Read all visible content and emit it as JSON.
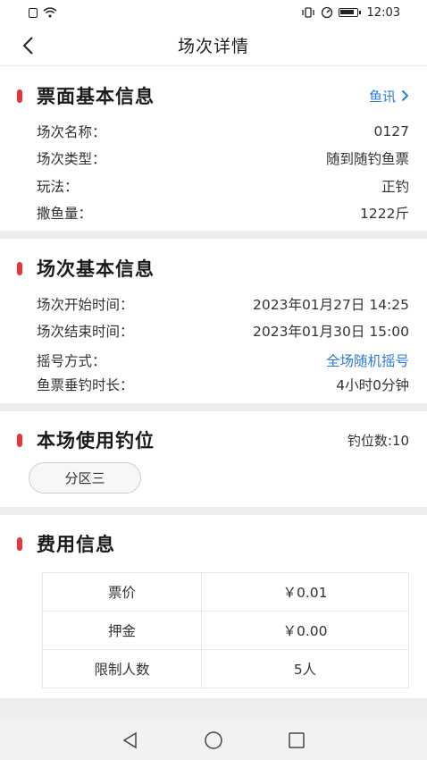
{
  "status_bar": {
    "time": "12:03"
  },
  "nav": {
    "title": "场次详情"
  },
  "ticket_info": {
    "title": "票面基本信息",
    "link": "鱼讯",
    "rows": [
      {
        "label": "场次名称：",
        "value": "0127"
      },
      {
        "label": "场次类型：",
        "value": "随到随钓鱼票"
      },
      {
        "label": "玩法：",
        "value": "正钓"
      },
      {
        "label": "撒鱼量：",
        "value": "1222斤"
      }
    ]
  },
  "session_info": {
    "title": "场次基本信息",
    "rows": [
      {
        "label": "场次开始时间：",
        "value": "2023年01月27日 14:25"
      },
      {
        "label": "场次结束时间：",
        "value": "2023年01月30日 15:00"
      },
      {
        "label": "摇号方式：",
        "value": "全场随机摇号"
      },
      {
        "label": "鱼票垂钓时长：",
        "value": "4小时0分钟"
      }
    ]
  },
  "spots": {
    "title": "本场使用钓位",
    "count": "钓位数:10",
    "zone": "分区三"
  },
  "fees": {
    "title": "费用信息",
    "rows": [
      {
        "label": "票价",
        "value": "￥0.01"
      },
      {
        "label": "押金",
        "value": "￥0.00"
      },
      {
        "label": "限制人数",
        "value": "5人"
      }
    ]
  },
  "colors": {
    "accent_red": "#e8343a",
    "link_blue": "#2b7be0",
    "gap_gray": "#eeeeee"
  },
  "icons": [
    "sim-icon",
    "wifi-icon",
    "vibrate-icon",
    "speed-icon",
    "battery-icon",
    "back-arrow-icon",
    "chevron-right-icon",
    "nav-back-icon",
    "nav-home-icon",
    "nav-recent-icon"
  ]
}
